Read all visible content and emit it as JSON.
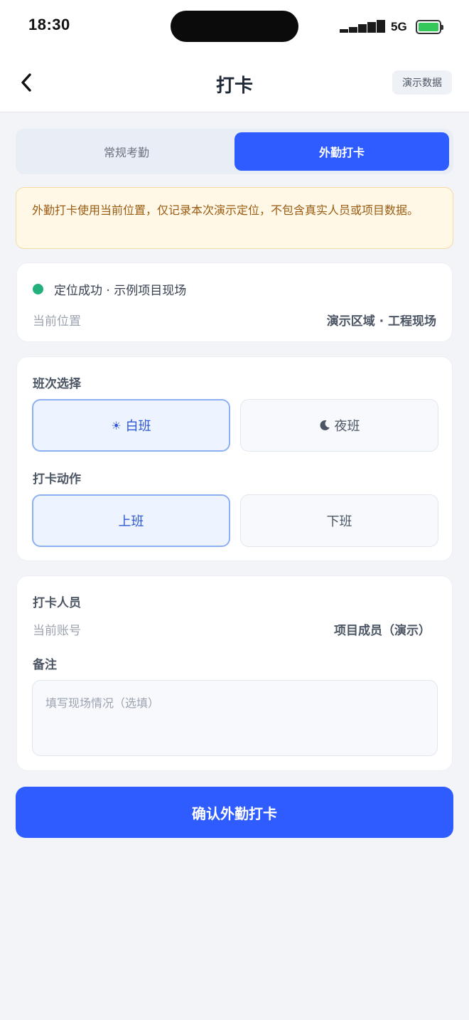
{
  "status_bar": {
    "time": "18:30",
    "network": "5G",
    "battery_level": 0.9,
    "battery_color": "#34c759"
  },
  "nav": {
    "back_icon": "chevron-left-icon",
    "title": "打卡",
    "demo_button": "演示数据"
  },
  "tabs": [
    {
      "label": "常规考勤",
      "active": false
    },
    {
      "label": "外勤打卡",
      "active": true
    }
  ],
  "notice": "外勤打卡使用当前位置，仅记录本次演示定位，不包含真实人员或项目数据。",
  "location": {
    "status_text": "定位成功 · 示例项目现场",
    "status_color": "#22b07d",
    "label": "当前位置",
    "value": "演示区域 · 工程现场"
  },
  "shift": {
    "title": "班次选择",
    "options": [
      {
        "label": "白班",
        "icon": "sun-icon",
        "selected": true
      },
      {
        "label": "夜班",
        "icon": "moon-icon",
        "selected": false
      }
    ]
  },
  "action": {
    "title": "打卡动作",
    "options": [
      {
        "label": "上班",
        "selected": true
      },
      {
        "label": "下班",
        "selected": false
      }
    ]
  },
  "person": {
    "title": "打卡人员",
    "label": "当前账号",
    "value": "项目成员（演示）"
  },
  "remark": {
    "title": "备注",
    "placeholder": "填写现场情况（选填）",
    "value": ""
  },
  "submit_label": "确认外勤打卡",
  "colors": {
    "primary": "#2f5cff",
    "background": "#f2f4f8",
    "notice_bg": "#fff8e6",
    "notice_text": "#9a5b12"
  }
}
